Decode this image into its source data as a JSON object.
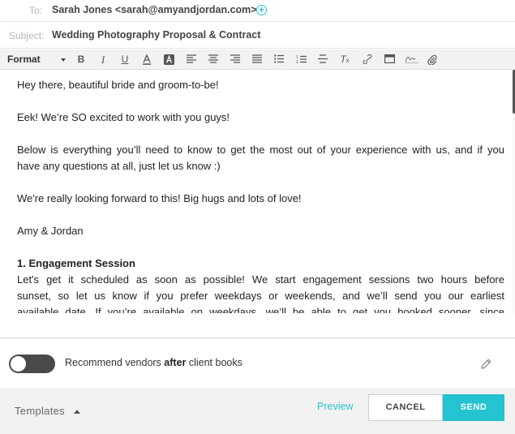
{
  "header": {
    "to_label": "To:",
    "to_value": "Sarah Jones <sarah@amyandjordan.com>",
    "subject_label": "Subject:",
    "subject_value": "Wedding Photography Proposal & Contract"
  },
  "toolbar": {
    "format_label": "Format",
    "buttons": [
      "bold",
      "italic",
      "underline",
      "text-color",
      "highlight",
      "align-left",
      "align-center",
      "align-right",
      "justify",
      "bulleted-list",
      "numbered-list",
      "strikethrough",
      "clear-formatting",
      "link",
      "embed",
      "signature",
      "attachment"
    ]
  },
  "body": {
    "p1": "Hey there, beautiful bride and groom-to-be!",
    "p2": "Eek! We’re SO excited to work with you guys!",
    "p3_line1": "Below is everything you’ll need to know to get the most out of your experience with us, and if you",
    "p3_line2": "have any questions at all, just let us know :)",
    "p4": "We're really looking forward to this! Big hugs and lots of love!",
    "p5": "Amy & Jordan",
    "section_heading": "1. Engagement Session",
    "s1_line1": "Let's get it scheduled as soon as possible! We start engagement sessions two hours before",
    "s1_line2": "sunset, so let us know if you prefer weekdays or weekends, and we’ll send you our earliest",
    "s1_line3": "available date. If you’re available on weekdays, we’ll be able to get you booked sooner, since"
  },
  "recommend": {
    "prefix": "Recommend vendors ",
    "bold": "after",
    "suffix": " client books",
    "enabled": false
  },
  "footer": {
    "templates_label": "Templates",
    "preview_label": "Preview",
    "cancel_label": "CANCEL",
    "send_label": "SEND"
  },
  "colors": {
    "accent": "#24c3d1",
    "toolbar_bg": "#f2f2f2",
    "toggle_off": "#4a4a4a"
  }
}
